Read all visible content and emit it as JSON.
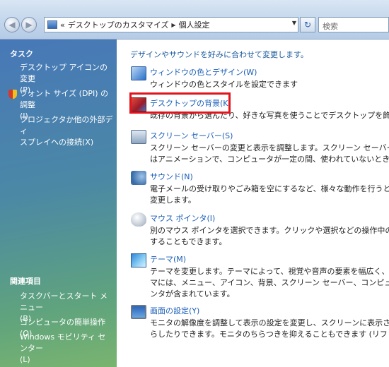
{
  "address_bar": {
    "back_icon": "back-arrow-icon",
    "forward_icon": "forward-arrow-icon",
    "breadcrumb_prefix": "«",
    "breadcrumb": [
      "デスクトップのカスタマイズ",
      "個人設定"
    ],
    "search_placeholder": "検索"
  },
  "sidebar": {
    "tasks_heading": "タスク",
    "task_links": [
      {
        "line1": "デスクトップ アイコンの変更",
        "line2": "(P)"
      },
      {
        "line1": "フォント サイズ (DPI) の調整",
        "line2": "(I)"
      },
      {
        "line1": "プロジェクタか他の外部ディ",
        "line2": "スプレイへの接続(X)"
      }
    ],
    "related_heading": "関連項目",
    "related_links": [
      {
        "line1": "タスクバーとスタート メニュー",
        "line2": "(B)"
      },
      {
        "line1": "コンピュータの簡単操作(O)",
        "line2": ""
      },
      {
        "line1": "Windows モビリティ センター",
        "line2": "(L)"
      }
    ]
  },
  "main": {
    "intro": "デザインやサウンドを好みに合わせて変更します。",
    "items": [
      {
        "icon": "window-color-icon",
        "title": "ウィンドウの色とデザイン(W)",
        "desc": "ウィンドウの色とスタイルを設定できます"
      },
      {
        "icon": "desktop-background-icon",
        "title": "デスクトップの背景(K)",
        "desc": "既存の背景から選んだり、好きな写真を使うことでデスクトップを飾るこ"
      },
      {
        "icon": "screensaver-icon",
        "title": "スクリーン セーバー(S)",
        "desc": "スクリーン セーバーの変更と表示を調整します。スクリーン セーバーとは、画\nはアニメーションで、コンピュータが一定の間、使われていないときに表示"
      },
      {
        "icon": "sound-icon",
        "title": "サウンド(N)",
        "desc": "電子メールの受け取りやごみ箱を空にするなど、様々な動作を行うときに再生\n変更します。"
      },
      {
        "icon": "mouse-pointer-icon",
        "title": "マウス ポインタ(I)",
        "desc": "別のマウス ポインタを選択できます。クリックや選択などの操作中のマウス ポ\nすることもできます。"
      },
      {
        "icon": "theme-icon",
        "title": "テーマ(M)",
        "desc": "テーマを変更します。テーマによって、視覚や音声の要素を幅広く、一度に変\nマには、メニュー、アイコン、背景、スクリーン セーバー、コンピュータの効果\nンタが含まれています。"
      },
      {
        "icon": "display-settings-icon",
        "title": "画面の設定(Y)",
        "desc": "モニタの解像度を調整して表示の設定を変更し、スクリーンに表示される項目\nらしたりできます。モニタのちらつきを抑えることもできます (リフレッシュ"
      }
    ]
  }
}
